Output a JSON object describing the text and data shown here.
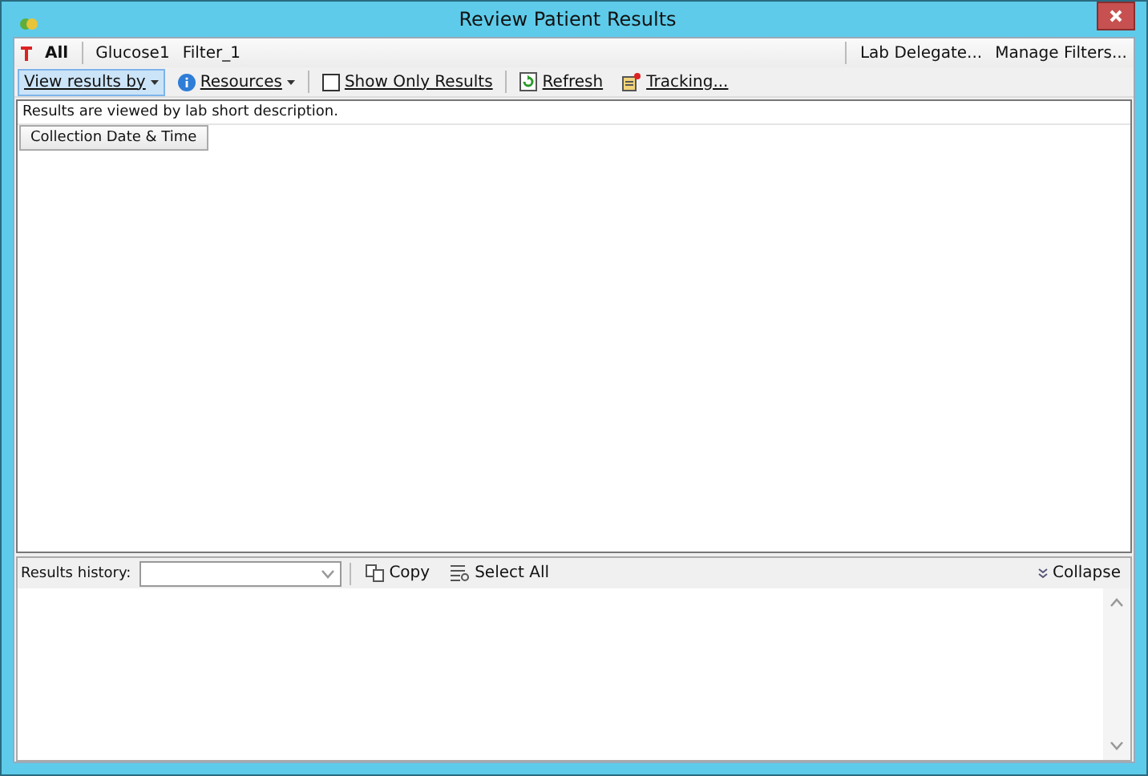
{
  "window": {
    "title": "Review Patient Results"
  },
  "filters": [
    {
      "label": "All",
      "selected": true
    },
    {
      "label": "Glucose1",
      "selected": false
    },
    {
      "label": "Filter_1",
      "selected": false
    }
  ],
  "filter_actions": [
    "Lab Delegate...",
    "Manage Filters..."
  ],
  "toolbar": [
    {
      "kind": "dropdown",
      "label": "View results by",
      "highlighted": true
    },
    {
      "kind": "dropdown",
      "label": "Resources",
      "highlighted": false
    },
    {
      "kind": "checkbox",
      "label": "Show Only Results",
      "checked": false
    },
    {
      "kind": "button",
      "label": "Refresh",
      "highlighted": false
    },
    {
      "kind": "button",
      "label": "Tracking...",
      "highlighted": false
    }
  ],
  "results": {
    "note": "Results are viewed by lab short description.",
    "column": "Collection Date & Time"
  },
  "history": {
    "label": "Results history:",
    "copy": "Copy",
    "select_all": "Select All",
    "collapse": "Collapse"
  }
}
